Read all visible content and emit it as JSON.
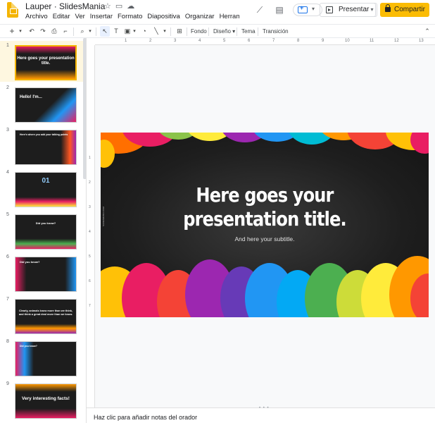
{
  "app": {
    "doc_title": "Lauper · SlidesMania",
    "menu": [
      "Archivo",
      "Editar",
      "Ver",
      "Insertar",
      "Formato",
      "Diapositiva",
      "Organizar",
      "Herramientas"
    ]
  },
  "header": {
    "present_label": "Presentar",
    "share_label": "Compartir"
  },
  "toolbar": {
    "fondo": "Fondo",
    "diseno": "Diseño",
    "tema": "Tema",
    "transicion": "Transición"
  },
  "ruler": {
    "h_ticks": [
      "1",
      "2",
      "3",
      "4",
      "5",
      "6",
      "7",
      "8",
      "9",
      "10",
      "11",
      "12",
      "13"
    ],
    "v_ticks": [
      "1",
      "2",
      "3",
      "4",
      "5",
      "6",
      "7"
    ]
  },
  "filmstrip": {
    "slides": [
      {
        "number": "1",
        "text": "Here goes your presentation title."
      },
      {
        "number": "2",
        "text": "Hello! I'm..."
      },
      {
        "number": "3",
        "text": "Here's where you add your talking points"
      },
      {
        "number": "4",
        "text": "01"
      },
      {
        "number": "5",
        "text": "Did you know?"
      },
      {
        "number": "6",
        "text": "Did you know?"
      },
      {
        "number": "7",
        "text": "Clearly, animals know more than we think, and think a great deal more than we know."
      },
      {
        "number": "8",
        "text": "Did you know?"
      },
      {
        "number": "9",
        "text": "Very interesting facts!"
      }
    ]
  },
  "slide": {
    "title_line1": "Here goes your",
    "title_line2": "presentation title.",
    "subtitle": "And here your subtitle.",
    "side_text": "SLIDESMANIA.COM"
  },
  "notes": {
    "placeholder": "Haz clic para añadir notas del orador"
  },
  "colors": {
    "accent": "#f4b400",
    "share": "#fbbc04",
    "slide_bg": "#1e1e1e"
  }
}
